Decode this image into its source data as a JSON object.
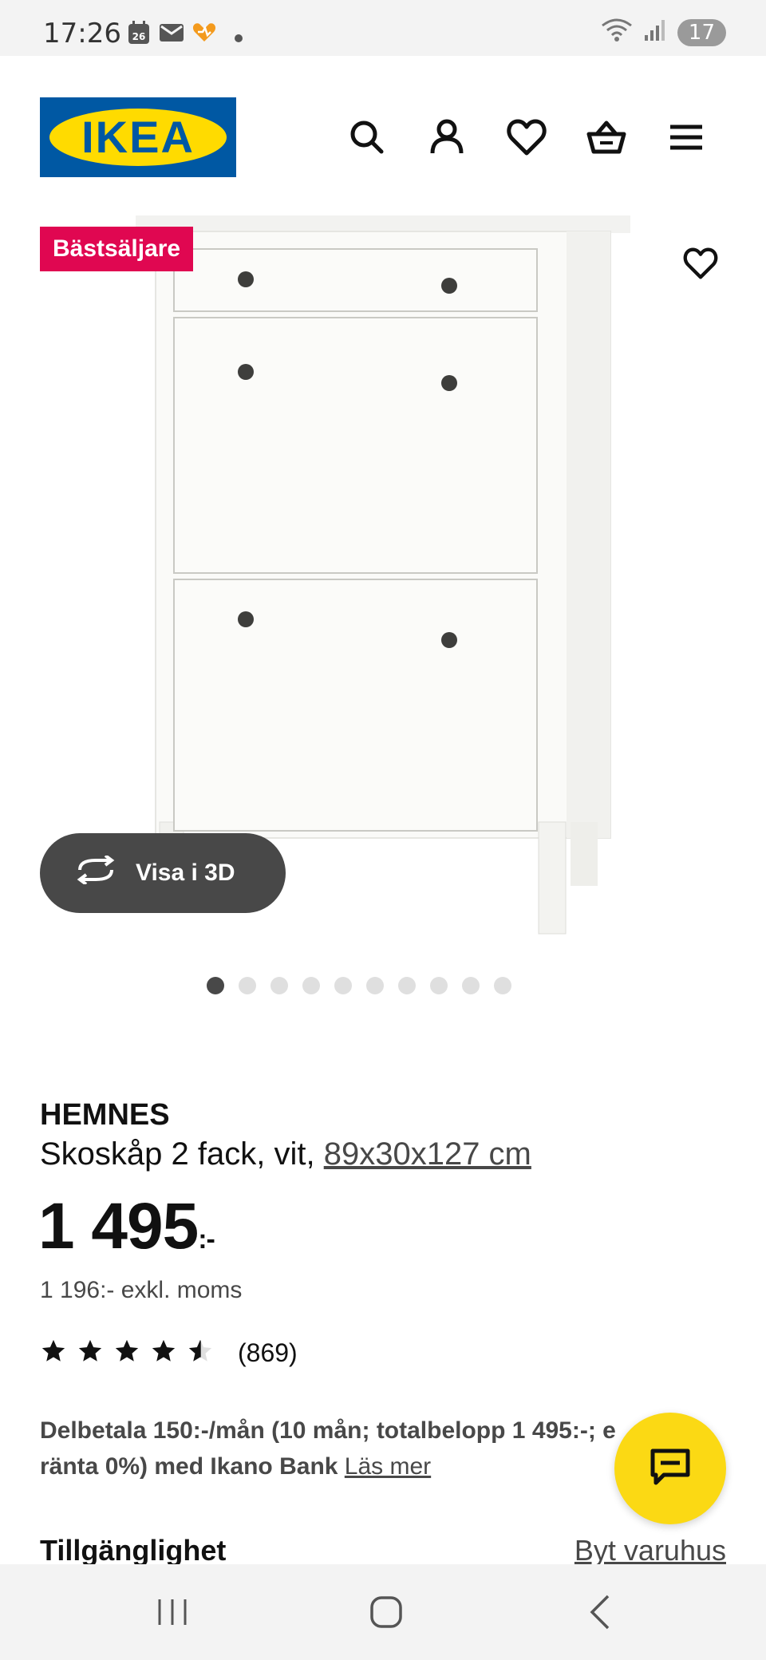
{
  "status_bar": {
    "time": "17:26",
    "calendar_day": "26",
    "battery": "17",
    "network": "5"
  },
  "header": {
    "logo_text": "IKEA",
    "icons": [
      "search-icon",
      "account-icon",
      "heart-icon",
      "basket-icon",
      "menu-icon"
    ]
  },
  "gallery": {
    "badge": "Bästsäljare",
    "view_3d_label": "Visa i 3D",
    "total_images": 10,
    "active_index": 0
  },
  "product": {
    "brand": "HEMNES",
    "description": "Skoskåp 2 fack, vit,",
    "dimensions": "89x30x127 cm",
    "price": "1 495",
    "price_unit": ":-",
    "price_ex_vat": "1 196:- exkl. moms",
    "rating": 4.5,
    "review_count": "(869)"
  },
  "finance": {
    "text_line1": "Delbetala 150:-/mån (10 mån; totalbelopp 1 495:-; e",
    "text_line2": "ränta 0%) med Ikano Bank",
    "link": "Läs mer"
  },
  "availability": {
    "title": "Tillgänglighet",
    "change_store": "Byt varuhus"
  },
  "colors": {
    "ikea_blue": "#0058a3",
    "ikea_yellow": "#ffdb00",
    "badge_red": "#e00751",
    "chat_yellow": "#fbd914",
    "dark_gray": "#484848"
  }
}
